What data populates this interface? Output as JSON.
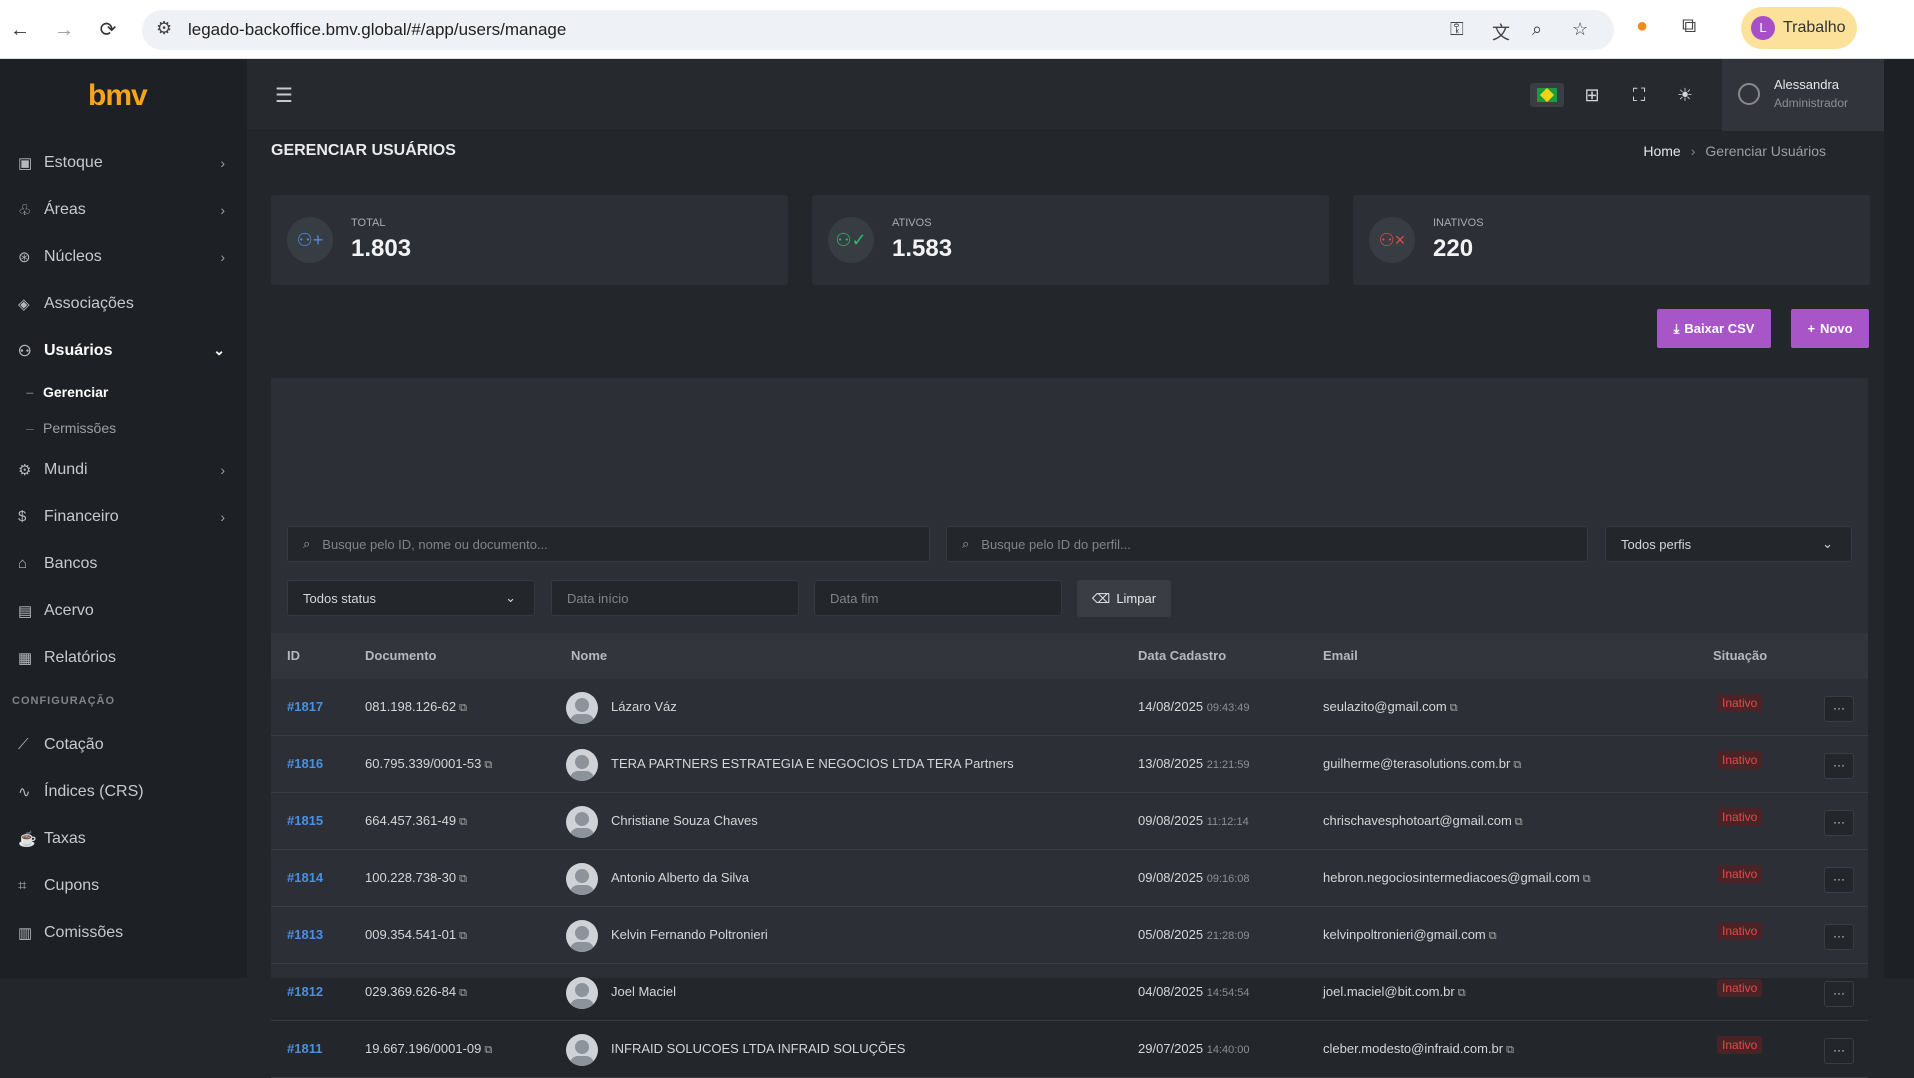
{
  "browser": {
    "url": "legado-backoffice.bmv.global/#/app/users/manage",
    "profile_initial": "L",
    "profile_label": "Trabalho"
  },
  "sidebar": {
    "logo": "bmv",
    "items": [
      {
        "label": "Estoque",
        "icon": "box-icon",
        "chevron": "›"
      },
      {
        "label": "Áreas",
        "icon": "tree-icon",
        "chevron": "›"
      },
      {
        "label": "Núcleos",
        "icon": "nucleus-icon",
        "chevron": "›"
      },
      {
        "label": "Associações",
        "icon": "layers-icon",
        "chevron": ""
      },
      {
        "label": "Usuários",
        "icon": "users-icon",
        "chevron": "⌄"
      }
    ],
    "subitems": [
      {
        "label": "Gerenciar"
      },
      {
        "label": "Permissões"
      }
    ],
    "items2": [
      {
        "label": "Mundi",
        "icon": "gear-icon",
        "chevron": "›"
      },
      {
        "label": "Financeiro",
        "icon": "dollar-icon",
        "chevron": "›"
      },
      {
        "label": "Bancos",
        "icon": "bank-icon",
        "chevron": ""
      },
      {
        "label": "Acervo",
        "icon": "file-icon",
        "chevron": ""
      },
      {
        "label": "Relatórios",
        "icon": "report-icon",
        "chevron": ""
      }
    ],
    "section": "CONFIGURAÇÃO",
    "items3": [
      {
        "label": "Cotação",
        "icon": "chart-icon"
      },
      {
        "label": "Índices (CRS)",
        "icon": "wave-icon"
      },
      {
        "label": "Taxas",
        "icon": "cup-icon"
      },
      {
        "label": "Cupons",
        "icon": "tag-icon"
      },
      {
        "label": "Comissões",
        "icon": "ledger-icon"
      }
    ]
  },
  "header": {
    "user_name": "Alessandra",
    "user_role": "Administrador"
  },
  "page": {
    "title": "GERENCIAR USUÁRIOS",
    "breadcrumb_home": "Home",
    "breadcrumb_sep": "›",
    "breadcrumb_current": "Gerenciar Usuários"
  },
  "stats": [
    {
      "label": "TOTAL",
      "value": "1.803",
      "color": "#4c8fe0"
    },
    {
      "label": "ATIVOS",
      "value": "1.583",
      "color": "#2db86a"
    },
    {
      "label": "INATIVOS",
      "value": "220",
      "color": "#e04a4a"
    }
  ],
  "actions": {
    "csv": "Baixar CSV",
    "new": "Novo"
  },
  "filters": {
    "search_placeholder": "Busque pelo ID, nome ou documento...",
    "profile_placeholder": "Busque pelo ID do perfil...",
    "profiles_select": "Todos perfis",
    "status_select": "Todos status",
    "start_placeholder": "Data início",
    "end_placeholder": "Data fim",
    "clear": "Limpar"
  },
  "table": {
    "columns": [
      "ID",
      "Documento",
      "Nome",
      "Data Cadastro",
      "Email",
      "Situação"
    ],
    "rows": [
      {
        "id": "#1817",
        "doc": "081.198.126-62",
        "name": "Lázaro Váz",
        "date": "14/08/2025",
        "time": "09:43:49",
        "email": "seulazito@gmail.com",
        "status": "Inativo"
      },
      {
        "id": "#1816",
        "doc": "60.795.339/0001-53",
        "name": "TERA PARTNERS ESTRATEGIA E NEGOCIOS LTDA TERA Partners",
        "date": "13/08/2025",
        "time": "21:21:59",
        "email": "guilherme@terasolutions.com.br",
        "status": "Inativo"
      },
      {
        "id": "#1815",
        "doc": "664.457.361-49",
        "name": "Christiane Souza Chaves",
        "date": "09/08/2025",
        "time": "11:12:14",
        "email": "chrischavesphotoart@gmail.com",
        "status": "Inativo"
      },
      {
        "id": "#1814",
        "doc": "100.228.738-30",
        "name": "Antonio Alberto da Silva",
        "date": "09/08/2025",
        "time": "09:16:08",
        "email": "hebron.negociosintermediacoes@gmail.com",
        "status": "Inativo"
      },
      {
        "id": "#1813",
        "doc": "009.354.541-01",
        "name": "Kelvin Fernando Poltronieri",
        "date": "05/08/2025",
        "time": "21:28:09",
        "email": "kelvinpoltronieri@gmail.com",
        "status": "Inativo"
      },
      {
        "id": "#1812",
        "doc": "029.369.626-84",
        "name": "Joel Maciel",
        "date": "04/08/2025",
        "time": "14:54:54",
        "email": "joel.maciel@bit.com.br",
        "status": "Inativo"
      },
      {
        "id": "#1811",
        "doc": "19.667.196/0001-09",
        "name": "INFRAID SOLUCOES LTDA INFRAID SOLUÇÕES",
        "date": "29/07/2025",
        "time": "14:40:00",
        "email": "cleber.modesto@infraid.com.br",
        "status": "Inativo"
      }
    ]
  }
}
